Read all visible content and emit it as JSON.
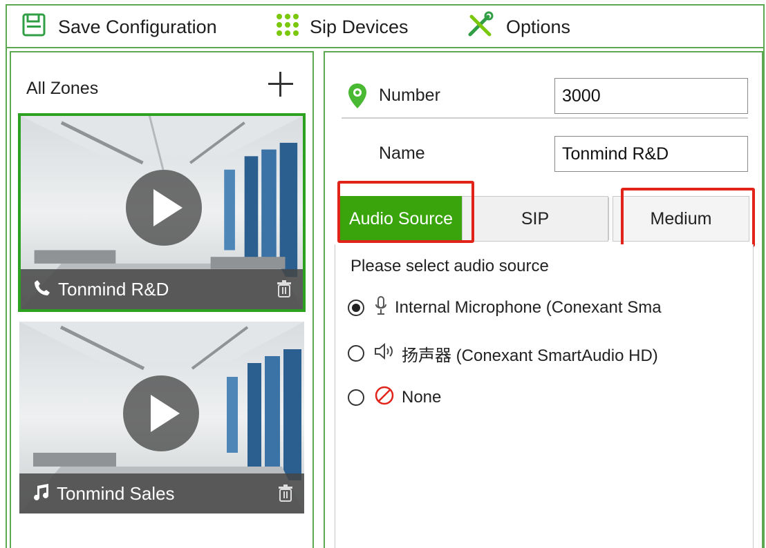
{
  "toolbar": {
    "save_label": "Save Configuration",
    "sip_label": "Sip Devices",
    "options_label": "Options",
    "icons": [
      "save-icon",
      "grid-icon",
      "tools-icon"
    ]
  },
  "zones": {
    "title": "All Zones",
    "add_icon": "plus-icon",
    "items": [
      {
        "name": "Tonmind R&D",
        "icon": "phone-icon",
        "selected": true
      },
      {
        "name": "Tonmind Sales",
        "icon": "music-note-icon",
        "selected": false
      }
    ]
  },
  "detail": {
    "number_label": "Number",
    "number_value": "3000",
    "name_label": "Name",
    "name_value": "Tonmind R&D",
    "tabs": [
      {
        "label": "Audio Source",
        "active": true,
        "highlighted": true
      },
      {
        "label": "SIP",
        "active": false,
        "highlighted": false
      },
      {
        "label": "Medium",
        "active": false,
        "highlighted": true
      }
    ],
    "audio_source": {
      "prompt": "Please select audio source",
      "options": [
        {
          "label": "Internal Microphone (Conexant Sma",
          "icon": "microphone-icon",
          "selected": true
        },
        {
          "label": "扬声器 (Conexant SmartAudio HD)",
          "icon": "speaker-icon",
          "selected": false
        },
        {
          "label": "None",
          "icon": "none-icon",
          "selected": false
        }
      ]
    }
  },
  "colors": {
    "frame_green": "#5aa94f",
    "tab_active": "#3aa40c",
    "highlight_red": "#e2231a",
    "selected_border": "#2ba11f"
  }
}
